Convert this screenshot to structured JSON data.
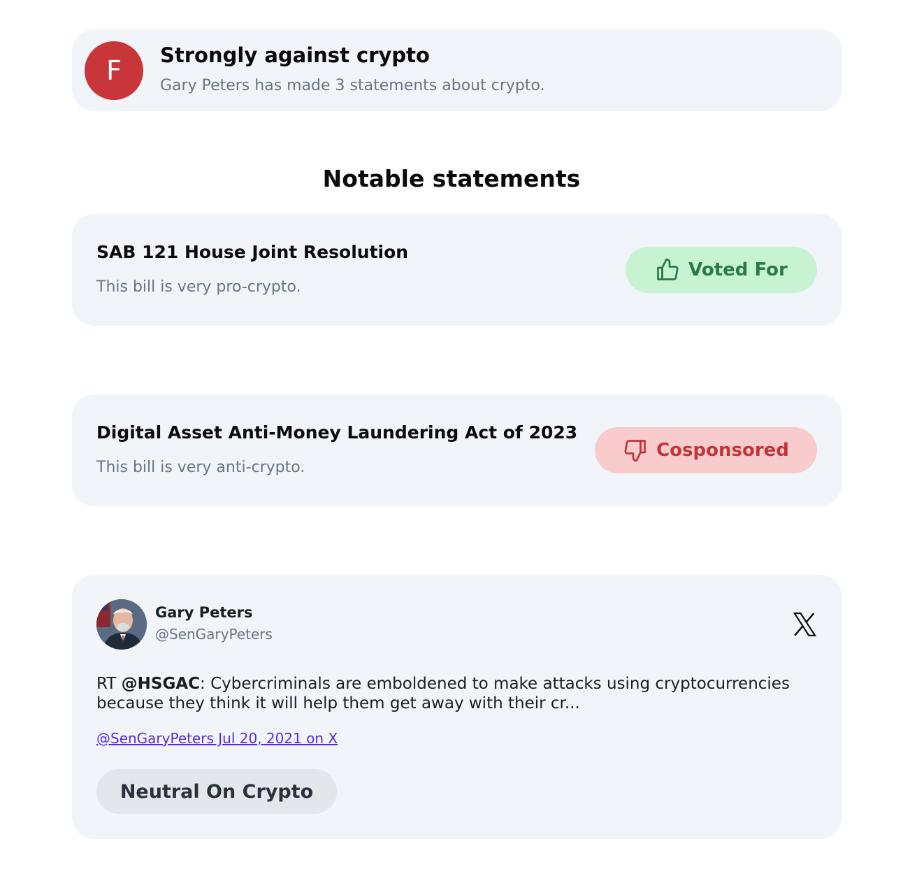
{
  "grade": {
    "letter": "F",
    "title": "Strongly against crypto",
    "subtitle": "Gary Peters has made 3 statements about crypto.",
    "badge_color": "#c8363a"
  },
  "section": {
    "heading": "Notable statements"
  },
  "bills": [
    {
      "title": "SAB 121 House Joint Resolution",
      "description": "This bill is very pro-crypto.",
      "action_label": "Voted For",
      "action_icon": "thumbs-up-icon",
      "pill_bg": "#c8f3d3",
      "pill_fg": "#2b7a43"
    },
    {
      "title": "Digital Asset Anti-Money Laundering Act of 2023",
      "description": "This bill is very anti-crypto.",
      "action_label": "Cosponsored",
      "action_icon": "thumbs-down-icon",
      "pill_bg": "#f8cccc",
      "pill_fg": "#c0353b"
    }
  ],
  "tweet": {
    "author_name": "Gary Peters",
    "author_handle": "@SenGaryPeters",
    "platform_icon": "x-logo-icon",
    "text_prefix": "RT ",
    "mention": "@HSGAC",
    "text_body": ": Cybercriminals are emboldened to make attacks using cryptocurrencies because they think it will help them get away with their cr...",
    "source_link": "@SenGaryPeters Jul 20, 2021 on X",
    "stance_label": "Neutral On Crypto"
  }
}
